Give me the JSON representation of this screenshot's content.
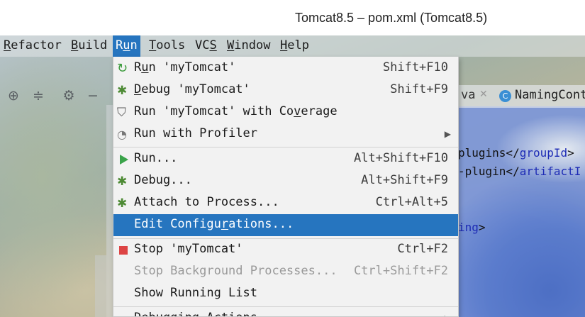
{
  "window": {
    "title": "Tomcat8.5 – pom.xml (Tomcat8.5)"
  },
  "menubar": {
    "items": [
      {
        "label": "Refactor",
        "mnemonic_index": 0
      },
      {
        "label": "Build",
        "mnemonic_index": 0
      },
      {
        "label": "Run",
        "mnemonic_index": 1,
        "active": true
      },
      {
        "label": "Tools",
        "mnemonic_index": 0
      },
      {
        "label": "VCS",
        "mnemonic_index": 2
      },
      {
        "label": "Window",
        "mnemonic_index": 0
      },
      {
        "label": "Help",
        "mnemonic_index": 0
      }
    ]
  },
  "toolbar_icons": [
    "crosshair-icon",
    "collapse-icon",
    "gear-icon",
    "minus-icon"
  ],
  "editor": {
    "tabs": [
      {
        "label": "va",
        "closable": true
      },
      {
        "label": "NamingCont",
        "icon": "C"
      }
    ],
    "code_lines": [
      {
        "pre": "plugins</",
        "tag": "groupId",
        "post": ">"
      },
      {
        "pre": "-plugin</",
        "tag": "artifactI",
        "post": ""
      },
      {
        "pre": "",
        "tag": "ing",
        "post": ">"
      }
    ]
  },
  "run_menu": {
    "items": [
      {
        "icon": "run-rerun-icon",
        "pre": "R",
        "mn": "u",
        "post": "n 'myTomcat'",
        "shortcut": "Shift+F10"
      },
      {
        "icon": "debug-bug-icon",
        "pre": "",
        "mn": "D",
        "post": "ebug 'myTomcat'",
        "shortcut": "Shift+F9"
      },
      {
        "icon": "coverage-shield-icon",
        "pre": "Run 'myTomcat' with Co",
        "mn": "v",
        "post": "erage",
        "shortcut": ""
      },
      {
        "icon": "profiler-icon",
        "pre": "Run with Profiler",
        "mn": "",
        "post": "",
        "shortcut": "",
        "submenu": true
      },
      {
        "separator": true
      },
      {
        "icon": "run-play-icon",
        "pre": "Run...",
        "mn": "",
        "post": "",
        "shortcut": "Alt+Shift+F10"
      },
      {
        "icon": "debug-bug-icon",
        "pre": "Debug...",
        "mn": "",
        "post": "",
        "shortcut": "Alt+Shift+F9"
      },
      {
        "icon": "attach-bug-icon",
        "pre": "Attach to Process...",
        "mn": "",
        "post": "",
        "shortcut": "Ctrl+Alt+5"
      },
      {
        "icon": "",
        "pre": "Edit Configu",
        "mn": "r",
        "post": "ations...",
        "shortcut": "",
        "selected": true
      },
      {
        "separator": true
      },
      {
        "icon": "stop-icon",
        "pre": "Stop 'myTomcat'",
        "mn": "",
        "post": "",
        "shortcut": "Ctrl+F2"
      },
      {
        "icon": "",
        "pre": "Stop Background Processes...",
        "mn": "",
        "post": "",
        "shortcut": "Ctrl+Shift+F2",
        "disabled": true
      },
      {
        "icon": "",
        "pre": "Show Running List",
        "mn": "",
        "post": "",
        "shortcut": ""
      },
      {
        "separator": true
      },
      {
        "icon": "",
        "pre": "Debugging Actions",
        "mn": "",
        "post": "",
        "shortcut": "",
        "submenu": true
      }
    ]
  },
  "colors": {
    "accent": "#2675bf",
    "menu_bg": "#f2f2f2",
    "disabled_text": "#9a9a9a"
  }
}
